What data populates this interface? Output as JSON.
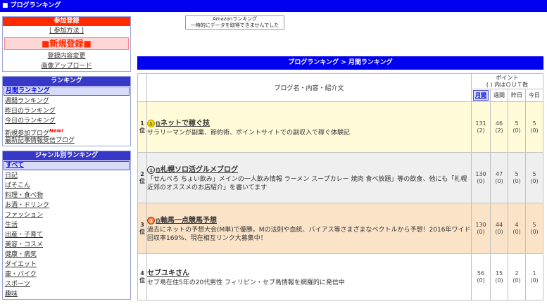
{
  "header": {
    "title": "■ ブログランキング"
  },
  "registration": {
    "heading": "参加登録",
    "how_to": "[ 参加方法 ]",
    "new_register": "■新規登録■",
    "change_info": "登録内容変更",
    "image_upload": "画像アップロード"
  },
  "ranking_nav": {
    "heading": "ランキング",
    "items": [
      {
        "label": "月間ランキング",
        "active": true
      },
      {
        "label": "週間ランキング"
      },
      {
        "label": "昨日のランキング"
      },
      {
        "label": "今日のランキング"
      },
      {
        "label": "新規参加ブログ",
        "badge": "New!"
      },
      {
        "label": "最新記事情報受信ブログ"
      }
    ]
  },
  "genre_nav": {
    "heading": "ジャンル別ランキング",
    "items": [
      "すべて",
      "日記",
      "ぱそこん",
      "料理・食べ物",
      "お酒・ドリンク",
      "ファッション",
      "生活",
      "出産・子育て",
      "美容・コスメ",
      "健康・病気",
      "ダイエット",
      "車・バイク",
      "スポーツ",
      "趣味"
    ]
  },
  "amazon": {
    "line1": "Amazonランキング",
    "line2": "一時的にデータを取得できませんでした"
  },
  "breadcrumb": "ブログランキング > 月間ランキング",
  "table": {
    "col_blog": "ブログ名・内容・紹介文",
    "col_point_1": "ポイント",
    "col_point_2": "( ) 内はＯＵＴ数",
    "periods": [
      "月間",
      "週間",
      "昨日",
      "今日"
    ],
    "rows": [
      {
        "rank": "1",
        "rank_suffix": "位",
        "mark": "①",
        "mark_suffix": "位",
        "name": "ネットで稼ぐ技",
        "desc": "サラリーマンが副業、節約術、ポイントサイトでの副収入で稼ぐ体験記",
        "points": [
          "131",
          "46",
          "5",
          "5"
        ],
        "outs": [
          "(2)",
          "(2)",
          "(0)",
          "(0)"
        ]
      },
      {
        "rank": "2",
        "rank_suffix": "位",
        "mark": "②",
        "mark_suffix": "位",
        "name": "札幌ソロ活グルメブログ",
        "desc": "「せんべろ ちょい飲み」メインの一人飲み情報 ラーメン スープカレー 焼肉 食べ放題」等の飲食、他にも「札幌近郊のオススメのお店紹介」を書いてます",
        "points": [
          "130",
          "47",
          "5",
          "5"
        ],
        "outs": [
          "(0)",
          "(0)",
          "(0)",
          "(0)"
        ]
      },
      {
        "rank": "3",
        "rank_suffix": "位",
        "mark": "③",
        "mark_suffix": "位",
        "name": "軸馬一点競馬予想",
        "desc": "過去にネットの予想大会(M単)で優勝。Mの法則や血統、バイアス等さまざまなベクトルから予想！2016年ワイド回収率169%、現在相互リンク大募集中！",
        "points": [
          "130",
          "44",
          "4",
          "5"
        ],
        "outs": [
          "(0)",
          "(0)",
          "(0)",
          "(0)"
        ]
      },
      {
        "rank": "4",
        "rank_suffix": "位",
        "mark": "",
        "mark_suffix": "",
        "name": "セブユキさん",
        "desc": "セブ島在住5年の20代男性 フィリピン・セブ島情報を網羅的に発信中",
        "points": [
          "56",
          "15",
          "2",
          "1"
        ],
        "outs": [
          "(0)",
          "(0)",
          "(0)",
          "(0)"
        ]
      }
    ]
  }
}
